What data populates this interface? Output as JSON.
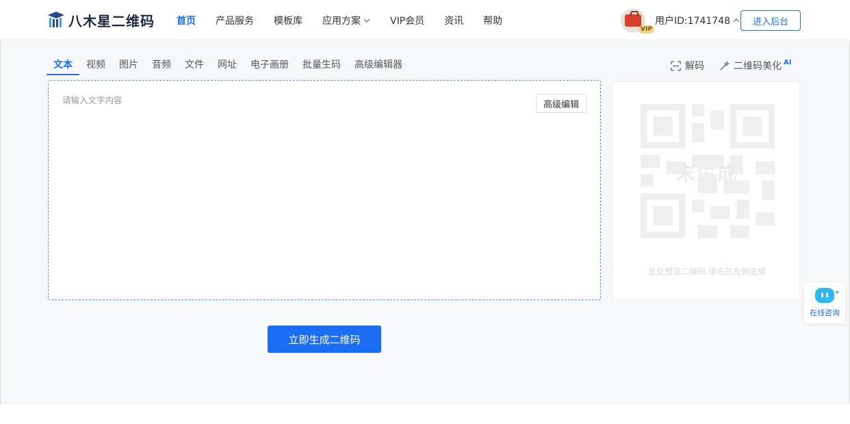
{
  "header": {
    "logo_text": "八木星二维码",
    "nav": [
      {
        "label": "首页",
        "active": true
      },
      {
        "label": "产品服务"
      },
      {
        "label": "模板库"
      },
      {
        "label": "应用方案",
        "has_dropdown": true
      },
      {
        "label": "VIP会员"
      },
      {
        "label": "资讯"
      },
      {
        "label": "帮助"
      }
    ],
    "user": {
      "vip_badge": "VIP",
      "id_label": "用户ID:1741748"
    },
    "backend_button": "进入后台"
  },
  "tabs": [
    {
      "label": "文本",
      "active": true
    },
    {
      "label": "视频"
    },
    {
      "label": "图片"
    },
    {
      "label": "音频"
    },
    {
      "label": "文件"
    },
    {
      "label": "网址"
    },
    {
      "label": "电子画册"
    },
    {
      "label": "批量生码"
    },
    {
      "label": "高级编辑器"
    }
  ],
  "tools": {
    "decode": "解码",
    "beautify": "二维码美化",
    "beautify_badge": "AI"
  },
  "editor": {
    "placeholder": "请输入文字内容",
    "value": "",
    "advanced_button": "高级编辑"
  },
  "preview": {
    "status": "未生成",
    "hint": "此处预览二维码 请先在左侧生成"
  },
  "generate_button": "立即生成二维码",
  "consult": {
    "label": "在线咨询"
  },
  "colors": {
    "accent": "#1b6ef3",
    "page_bg": "#f7f8fa",
    "bot": "#2db7f5"
  }
}
